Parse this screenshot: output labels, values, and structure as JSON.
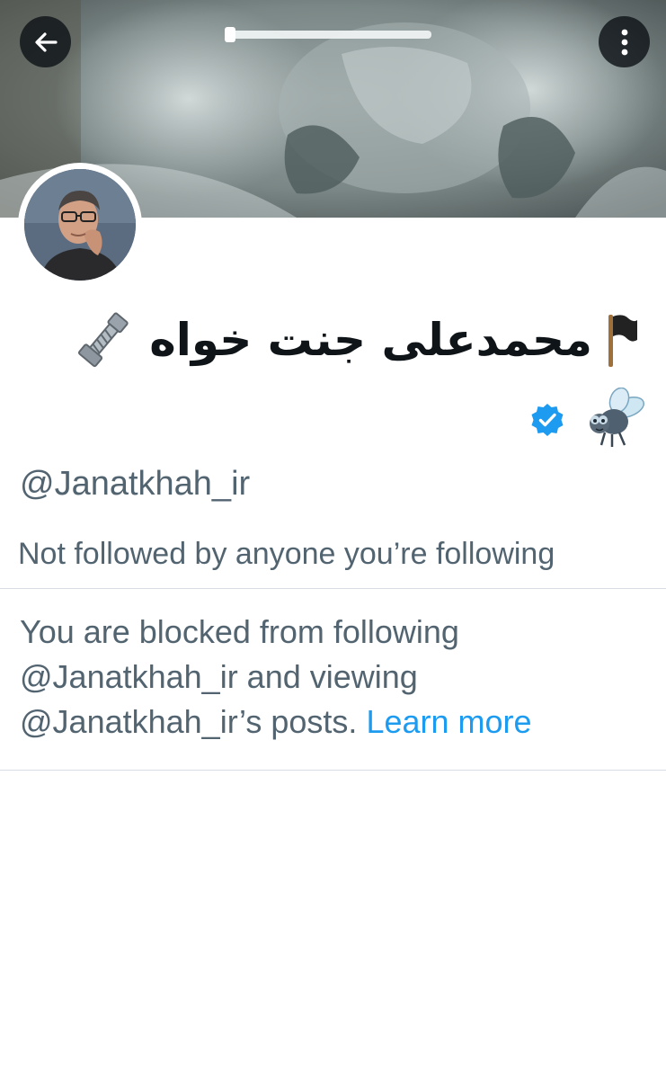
{
  "header": {
    "back_icon": "arrow-left-icon",
    "more_icon": "vertical-ellipsis-icon"
  },
  "profile": {
    "display_name": "محمدعلی جنت خواه",
    "name_prefix_emoji": "black-flag-icon",
    "name_suffix_emoji": "nut-and-bolt-icon",
    "verified_badge": "verified-badge-icon",
    "badge_emoji": "fly-icon",
    "handle": "@Janatkhah_ir",
    "followers_note": "Not followed by anyone you’re following"
  },
  "blocked": {
    "line1": "You are blocked from following",
    "line2": "@Janatkhah_ir and viewing",
    "line3": "@Janatkhah_ir’s posts.",
    "learn_more": "Learn more"
  },
  "colors": {
    "secondary_text": "#536471",
    "link": "#1d9bf0",
    "verified": "#1d9bf0",
    "divider": "#d7dde2"
  }
}
